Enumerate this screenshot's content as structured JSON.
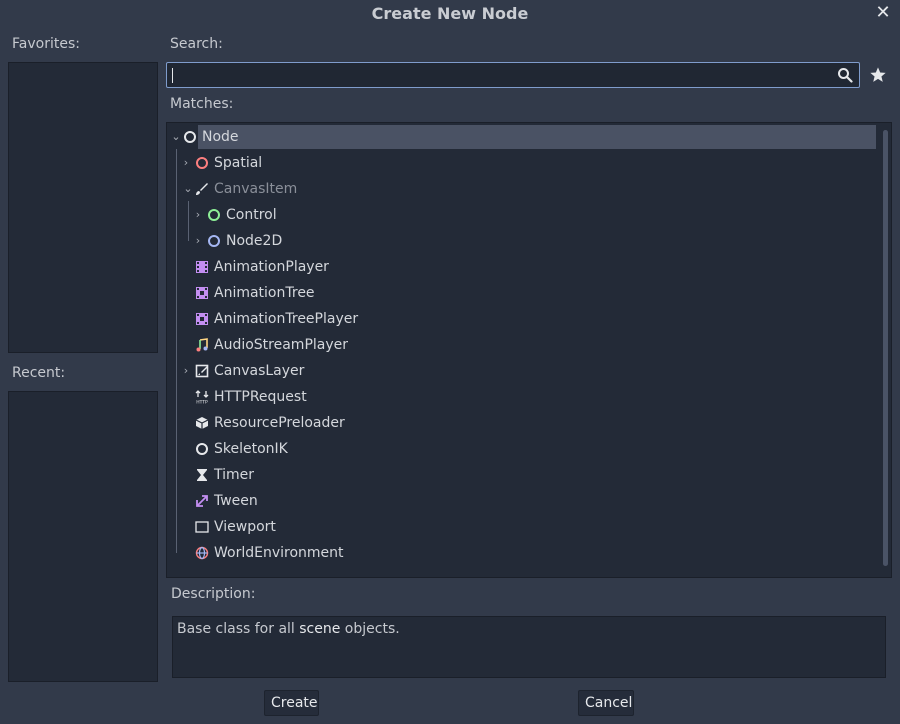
{
  "dialog": {
    "title": "Create New Node",
    "close_glyph": "✕"
  },
  "sidebar": {
    "favorites_label": "Favorites:",
    "recent_label": "Recent:"
  },
  "search": {
    "label": "Search:",
    "value": "",
    "placeholder": ""
  },
  "matches": {
    "label": "Matches:",
    "items": [
      {
        "label": "Node",
        "icon": "node-circle-icon",
        "icon_color": "#e6e8eb",
        "expanded": true,
        "selected": true
      },
      {
        "label": "Spatial",
        "icon": "spatial-circle-icon",
        "icon_color": "#fc7f7f",
        "collapsed": true
      },
      {
        "label": "CanvasItem",
        "icon": "canvas-item-brush-icon",
        "icon_color": "#e6e8eb",
        "expanded": true,
        "dim": true
      },
      {
        "label": "Control",
        "icon": "control-circle-icon",
        "icon_color": "#8eef97",
        "collapsed": true
      },
      {
        "label": "Node2D",
        "icon": "node2d-circle-icon",
        "icon_color": "#a5b7f3",
        "collapsed": true
      },
      {
        "label": "AnimationPlayer",
        "icon": "animation-player-icon",
        "icon_color": "#c38ef1"
      },
      {
        "label": "AnimationTree",
        "icon": "animation-tree-icon",
        "icon_color": "#c38ef1"
      },
      {
        "label": "AnimationTreePlayer",
        "icon": "animation-tree-player-icon",
        "icon_color": "#c38ef1"
      },
      {
        "label": "AudioStreamPlayer",
        "icon": "audio-stream-player-icon",
        "icon_color": "#ffd684"
      },
      {
        "label": "CanvasLayer",
        "icon": "canvas-layer-icon",
        "icon_color": "#e6e8eb",
        "collapsed": true
      },
      {
        "label": "HTTPRequest",
        "icon": "http-request-icon",
        "icon_color": "#e6e8eb"
      },
      {
        "label": "ResourcePreloader",
        "icon": "resource-preloader-icon",
        "icon_color": "#e6e8eb"
      },
      {
        "label": "SkeletonIK",
        "icon": "skeleton-ik-icon",
        "icon_color": "#e6e8eb"
      },
      {
        "label": "Timer",
        "icon": "timer-hourglass-icon",
        "icon_color": "#e6e8eb"
      },
      {
        "label": "Tween",
        "icon": "tween-icon",
        "icon_color": "#c38ef1"
      },
      {
        "label": "Viewport",
        "icon": "viewport-icon",
        "icon_color": "#e6e8eb"
      },
      {
        "label": "WorldEnvironment",
        "icon": "world-environment-icon",
        "icon_color": "#fc7f7f"
      }
    ]
  },
  "description": {
    "label": "Description:",
    "text_before": "Base class for all ",
    "highlight": "scene",
    "text_after": " objects."
  },
  "buttons": {
    "create": "Create",
    "cancel": "Cancel"
  }
}
